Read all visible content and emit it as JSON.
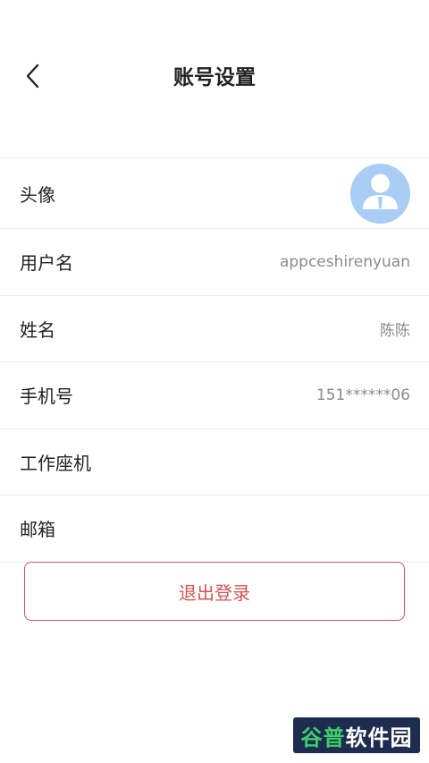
{
  "header": {
    "title": "账号设置",
    "back_icon": "chevron-left-icon"
  },
  "rows": [
    {
      "label": "头像",
      "value": "",
      "icon": "user-avatar-icon"
    },
    {
      "label": "用户名",
      "value": "appceshirenyuan"
    },
    {
      "label": "姓名",
      "value": "陈陈"
    },
    {
      "label": "手机号",
      "value": "151******06"
    },
    {
      "label": "工作座机",
      "value": ""
    },
    {
      "label": "邮箱",
      "value": ""
    }
  ],
  "logout": {
    "label": "退出登录"
  },
  "watermark": {
    "part1": "谷普",
    "part2": "软件园"
  },
  "colors": {
    "danger": "#d9534f",
    "avatar_bg": "#a9cdf5",
    "value_text": "#8a8a8a"
  }
}
